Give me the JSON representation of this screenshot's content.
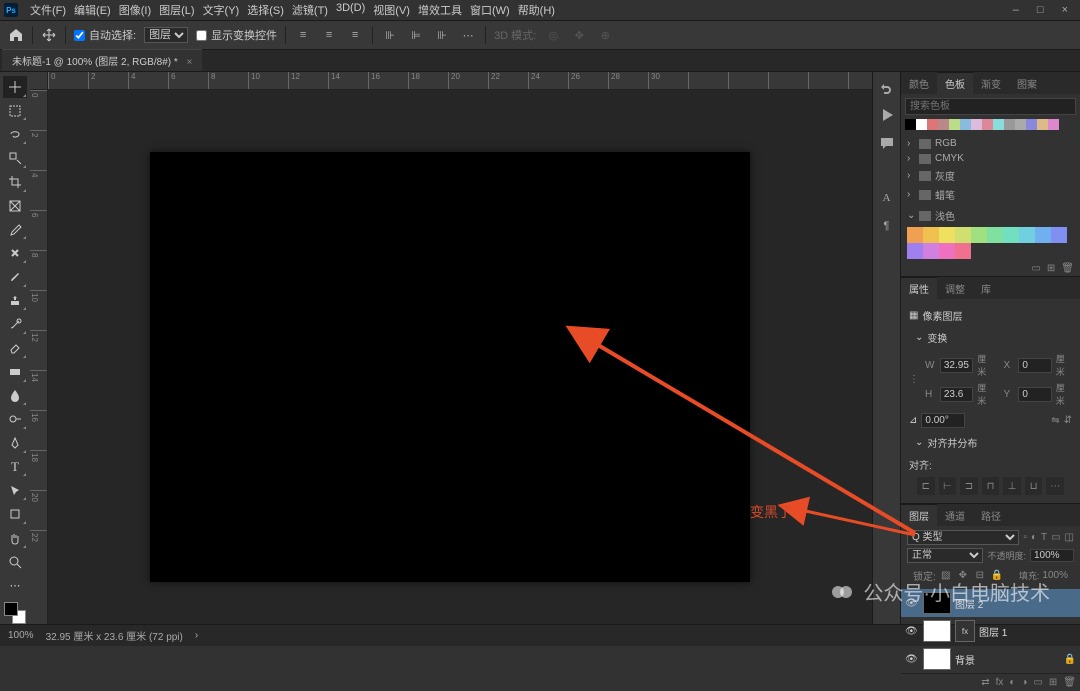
{
  "menu": [
    "文件(F)",
    "编辑(E)",
    "图像(I)",
    "图层(L)",
    "文字(Y)",
    "选择(S)",
    "滤镜(T)",
    "3D(D)",
    "视图(V)",
    "增效工具",
    "窗口(W)",
    "帮助(H)"
  ],
  "window": {
    "min": "–",
    "max": "□",
    "close": "×"
  },
  "toolbar": {
    "auto_select": "自动选择:",
    "layer_select": "图层",
    "show_transform": "显示变换控件",
    "mode_3d": "3D 模式:"
  },
  "tab_title": "未标题-1 @ 100% (图层 2, RGB/8#) *",
  "ruler_h": [
    "0",
    "2",
    "4",
    "6",
    "8",
    "10",
    "12",
    "14",
    "16",
    "18",
    "20",
    "22",
    "24",
    "26",
    "28",
    "30",
    "",
    "",
    "",
    "",
    ""
  ],
  "ruler_v": [
    "0",
    "2",
    "4",
    "6",
    "8",
    "10",
    "12",
    "14",
    "16",
    "18",
    "20",
    "22"
  ],
  "color_panel": {
    "tabs": [
      "颜色",
      "色板",
      "渐变",
      "图案"
    ],
    "active": 1,
    "search_ph": "搜索色板",
    "row_colors": [
      "#000",
      "#fff",
      "#d77",
      "#b88",
      "#bd8",
      "#8bd",
      "#dbd",
      "#d89",
      "#8dd",
      "#999",
      "#aaa",
      "#88d",
      "#db8",
      "#d8c"
    ],
    "folders": [
      "RGB",
      "CMYK",
      "灰度",
      "蜡笔"
    ],
    "open_folder": "浅色",
    "light": [
      "#f0a050",
      "#f0c050",
      "#f0e060",
      "#d0e070",
      "#a0e080",
      "#80e0a0",
      "#70e0c0",
      "#70d0e0",
      "#70b0f0",
      "#8090f0",
      "#a080f0",
      "#d080e0",
      "#f070c0",
      "#f07090"
    ]
  },
  "props": {
    "tabs": [
      "属性",
      "调整",
      "库"
    ],
    "type": "像素图层",
    "transform": "变换",
    "w": "32.95",
    "wu": "厘米",
    "x": "0",
    "xu": "厘米",
    "h": "23.6",
    "hu": "厘米",
    "y": "0",
    "yu": "厘米",
    "angle": "0.00°",
    "align": "对齐并分布",
    "align_label": "对齐:"
  },
  "layers_panel": {
    "tabs": [
      "图层",
      "通道",
      "路径"
    ],
    "kind": "Q 类型",
    "blend": "正常",
    "opacity_lbl": "不透明度:",
    "opacity": "100%",
    "lock_lbl": "锁定:",
    "fill_lbl": "填充:",
    "fill": "100%",
    "items": [
      {
        "name": "图层 2",
        "sel": true,
        "thumb": "#000"
      },
      {
        "name": "图层 1",
        "sel": false,
        "thumb": "#fff",
        "fx": true
      },
      {
        "name": "背景",
        "sel": false,
        "thumb": "#fff",
        "locked": true
      }
    ]
  },
  "status": {
    "zoom": "100%",
    "info": "32.95 厘米 x 23.6 厘米 (72 ppi)"
  },
  "annotation": "变黑了",
  "watermark": "公众号·小白电脑技术"
}
